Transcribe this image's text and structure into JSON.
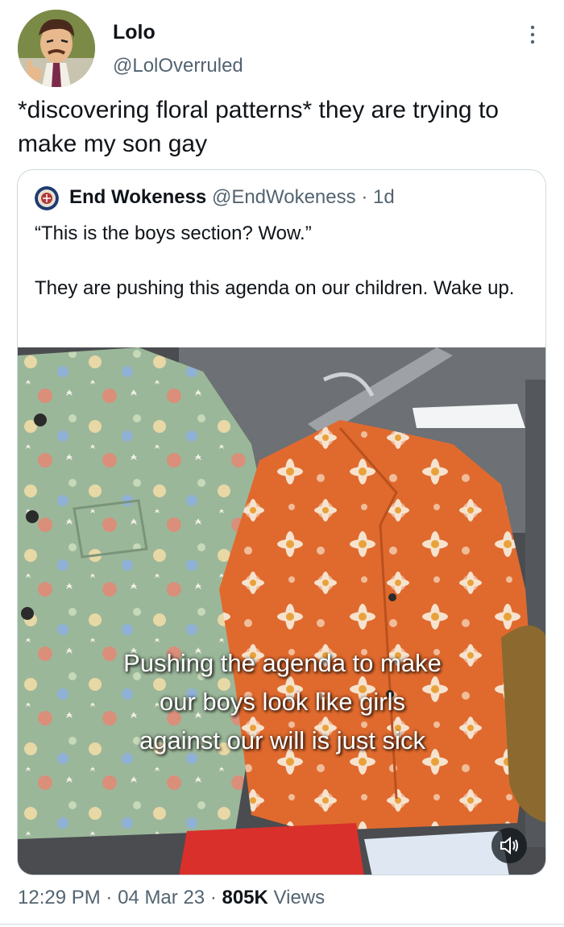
{
  "author": {
    "display_name": "Lolo",
    "handle": "@LolOverruled"
  },
  "tweet": {
    "text": "*discovering floral patterns* they are trying to make my son gay"
  },
  "quoted_tweet": {
    "display_name": "End Wokeness",
    "handle": "@EndWokeness",
    "separator": "·",
    "time": "1d",
    "text": "“This is the boys section? Wow.”\n\nThey are pushing this agenda on our children. Wake up.",
    "media": {
      "caption_lines": [
        "Pushing the agenda to make",
        "our boys look like girls",
        "against our will is just sick"
      ],
      "mute_icon": "speaker-muted-icon"
    }
  },
  "meta": {
    "time": "12:29 PM",
    "separator": "·",
    "date": "04 Mar 23",
    "views_count": "805K",
    "views_label": "Views"
  },
  "colors": {
    "text_primary": "#0f1419",
    "text_secondary": "#536471",
    "border": "#cfd9de",
    "orange_shirt": "#e06a2e",
    "green_shirt": "#9bb79a"
  }
}
